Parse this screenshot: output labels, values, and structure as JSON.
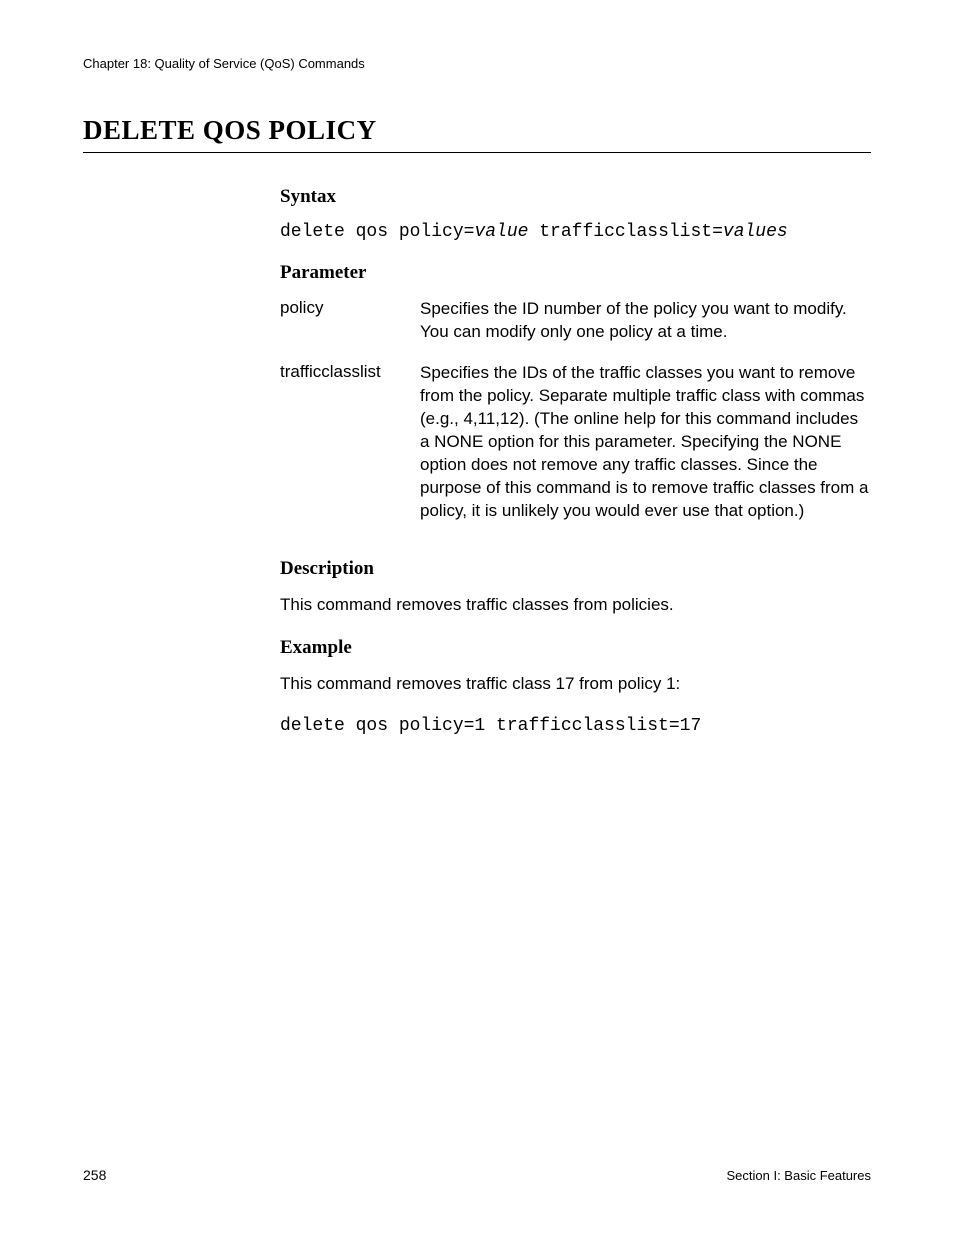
{
  "header": {
    "chapter": "Chapter 18: Quality of Service (QoS) Commands"
  },
  "title": "DELETE QOS POLICY",
  "sections": {
    "syntax": {
      "heading": "Syntax",
      "prefix": "delete qos policy=",
      "arg1": "value",
      "middle": " trafficclasslist=",
      "arg2": "values"
    },
    "parameter": {
      "heading": "Parameter",
      "rows": [
        {
          "name": "policy",
          "desc": "Specifies the ID number of the policy you want to modify. You can modify only one policy at a time."
        },
        {
          "name": "trafficclasslist",
          "desc": "Specifies the IDs of the traffic classes you want to remove from the policy. Separate multiple traffic class with commas (e.g., 4,11,12). (The online help for this command includes a NONE option for this parameter. Specifying the NONE option does not remove any traffic classes. Since the purpose of this command is to remove traffic classes from a policy, it is unlikely you would ever use that option.)"
        }
      ]
    },
    "description": {
      "heading": "Description",
      "text": "This command removes traffic classes from policies."
    },
    "example": {
      "heading": "Example",
      "text": "This command removes traffic class 17 from policy 1:",
      "code": "delete qos policy=1 trafficclasslist=17"
    }
  },
  "footer": {
    "page": "258",
    "section": "Section I: Basic Features"
  }
}
